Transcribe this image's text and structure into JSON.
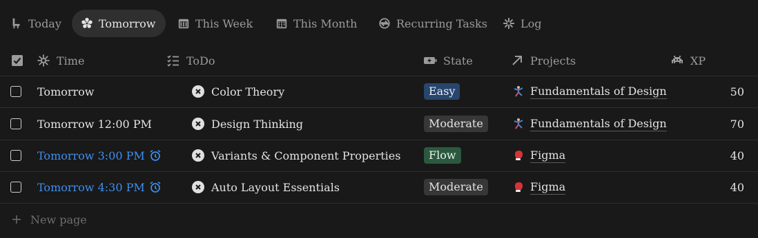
{
  "tabs": [
    {
      "label": "Today",
      "icon": "chair-icon"
    },
    {
      "label": "Tomorrow",
      "icon": "burst-icon",
      "active": true
    },
    {
      "label": "This Week",
      "icon": "calendar-week-icon"
    },
    {
      "label": "This Month",
      "icon": "calendar-month-icon"
    },
    {
      "label": "Recurring Tasks",
      "icon": "recurring-icon"
    },
    {
      "label": "Log",
      "icon": "log-icon"
    }
  ],
  "columns": {
    "select": {
      "icon": "checkbox-checked-icon"
    },
    "time": {
      "label": "Time",
      "icon": "sparkle-icon"
    },
    "todo": {
      "label": "ToDo",
      "icon": "checklist-icon"
    },
    "state": {
      "label": "State",
      "icon": "battery-charging-icon"
    },
    "projects": {
      "label": "Projects",
      "icon": "arrow-up-right-icon"
    },
    "xp": {
      "label": "XP",
      "icon": "invader-icon"
    }
  },
  "rows": [
    {
      "time": "Tomorrow",
      "time_highlight": false,
      "todo": "Color Theory",
      "state": "Easy",
      "state_color": "#28456c",
      "project": "Fundamentals of Design",
      "project_icon": "acrobat-icon",
      "xp": "50"
    },
    {
      "time": "Tomorrow 12:00 PM",
      "time_highlight": false,
      "todo": "Design Thinking",
      "state": "Moderate",
      "state_color": "#373737",
      "project": "Fundamentals of Design",
      "project_icon": "acrobat-icon",
      "xp": "70"
    },
    {
      "time": "Tomorrow 3:00 PM",
      "time_highlight": true,
      "todo": "Variants & Component Properties",
      "state": "Flow",
      "state_color": "#2b593f",
      "project": "Figma",
      "project_icon": "boxing-glove-icon",
      "xp": "40"
    },
    {
      "time": "Tomorrow 4:30 PM",
      "time_highlight": true,
      "todo": "Auto Layout Essentials",
      "state": "Moderate",
      "state_color": "#373737",
      "project": "Figma",
      "project_icon": "boxing-glove-icon",
      "xp": "40"
    }
  ],
  "footer": {
    "new_page_label": "New page"
  },
  "colors": {
    "background": "#191919",
    "reminder": "#3d8ff1",
    "text": "#e3e3e3",
    "muted": "#9b9b9b"
  }
}
